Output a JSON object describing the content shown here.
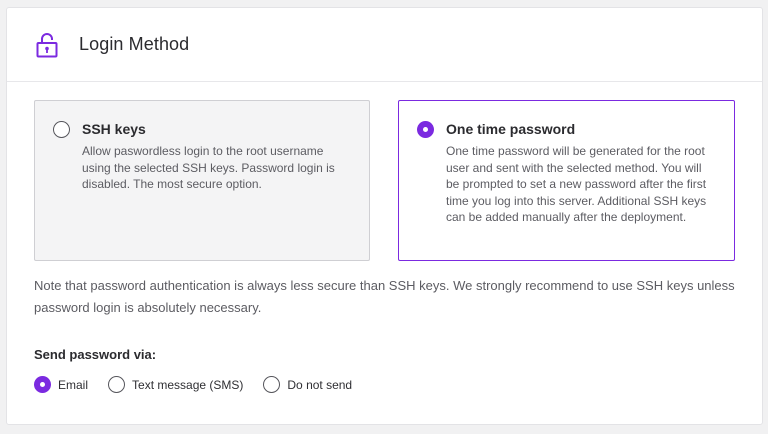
{
  "header": {
    "title": "Login Method",
    "icon": "lock-open-icon"
  },
  "options": {
    "ssh": {
      "title": "SSH keys",
      "description": "Allow paswordless login to the root username using the selected SSH keys. Password login is disabled. The most secure option.",
      "selected": false
    },
    "otp": {
      "title": "One time password",
      "description": "One time password will be generated for the root user and sent with the selected method. You will be prompted to set a new password after the first time you log into this server. Additional SSH keys can be added manually after the deployment.",
      "selected": true
    }
  },
  "note": "Note that password authentication is always less secure than SSH keys. We strongly recommend to use SSH keys unless password login is absolutely necessary.",
  "send": {
    "label": "Send password via:",
    "choices": [
      {
        "label": "Email",
        "selected": true
      },
      {
        "label": "Text message (SMS)",
        "selected": false
      },
      {
        "label": "Do not send",
        "selected": false
      }
    ]
  },
  "colors": {
    "accent": "#7b2ae0"
  }
}
